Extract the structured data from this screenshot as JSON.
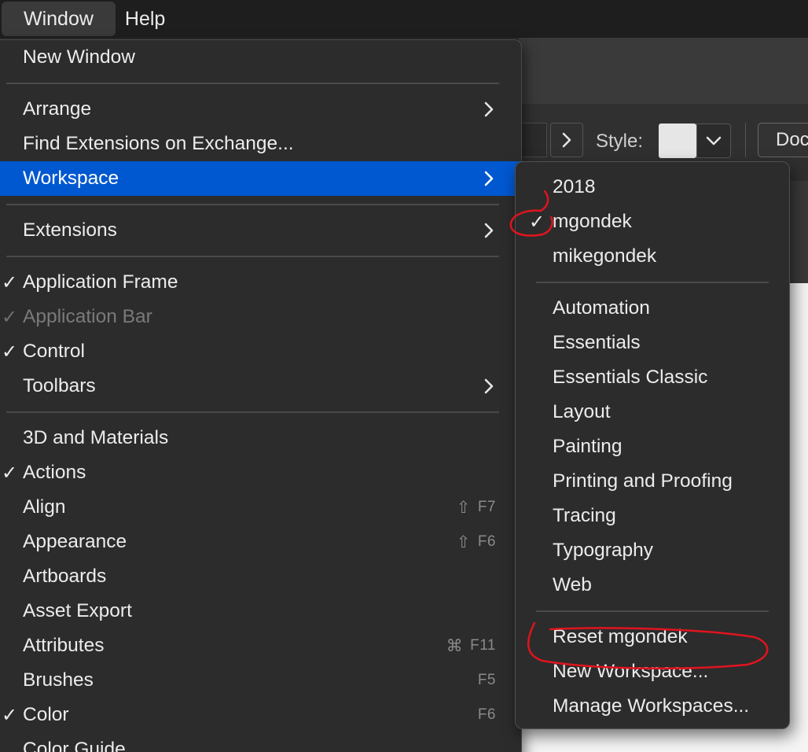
{
  "menubar": {
    "items": [
      {
        "label": "Window"
      },
      {
        "label": "Help"
      }
    ]
  },
  "toolbar": {
    "style_label": "Style:",
    "doc_button_label": "Document Setup"
  },
  "window_menu": {
    "items": [
      {
        "label": "New Window"
      },
      {
        "label": "Arrange",
        "submenu": true
      },
      {
        "label": "Find Extensions on Exchange..."
      },
      {
        "label": "Workspace",
        "submenu": true,
        "highlighted": true
      },
      {
        "label": "Extensions",
        "submenu": true
      },
      {
        "label": "Application Frame",
        "checked": true
      },
      {
        "label": "Application Bar",
        "checked": true,
        "disabled": true
      },
      {
        "label": "Control",
        "checked": true
      },
      {
        "label": "Toolbars",
        "submenu": true
      },
      {
        "label": "3D and Materials"
      },
      {
        "label": "Actions",
        "checked": true
      },
      {
        "label": "Align",
        "shortcut": "F7",
        "shortcut_icon": "shift-icon"
      },
      {
        "label": "Appearance",
        "shortcut": "F6",
        "shortcut_icon": "shift-icon"
      },
      {
        "label": "Artboards"
      },
      {
        "label": "Asset Export"
      },
      {
        "label": "Attributes",
        "shortcut": "F11",
        "shortcut_icon": "command-icon"
      },
      {
        "label": "Brushes",
        "shortcut": "F5"
      },
      {
        "label": "Color",
        "checked": true,
        "shortcut": "F6"
      },
      {
        "label": "Color Guide"
      }
    ]
  },
  "workspace_submenu": {
    "items": [
      {
        "label": "2018"
      },
      {
        "label": "mgondek",
        "checked": true
      },
      {
        "label": "mikegondek"
      },
      {
        "label": "Automation"
      },
      {
        "label": "Essentials"
      },
      {
        "label": "Essentials Classic"
      },
      {
        "label": "Layout"
      },
      {
        "label": "Painting"
      },
      {
        "label": "Printing and Proofing"
      },
      {
        "label": "Tracing"
      },
      {
        "label": "Typography"
      },
      {
        "label": "Web"
      },
      {
        "label": "Reset mgondek"
      },
      {
        "label": "New Workspace..."
      },
      {
        "label": "Manage Workspaces..."
      }
    ]
  },
  "glyphs": {
    "check": "✓",
    "shift": "⇧",
    "command": "⌘"
  },
  "colors": {
    "highlight": "#0058d0",
    "annotation": "#e0141e",
    "menu_bg": "#2c2c2c"
  }
}
